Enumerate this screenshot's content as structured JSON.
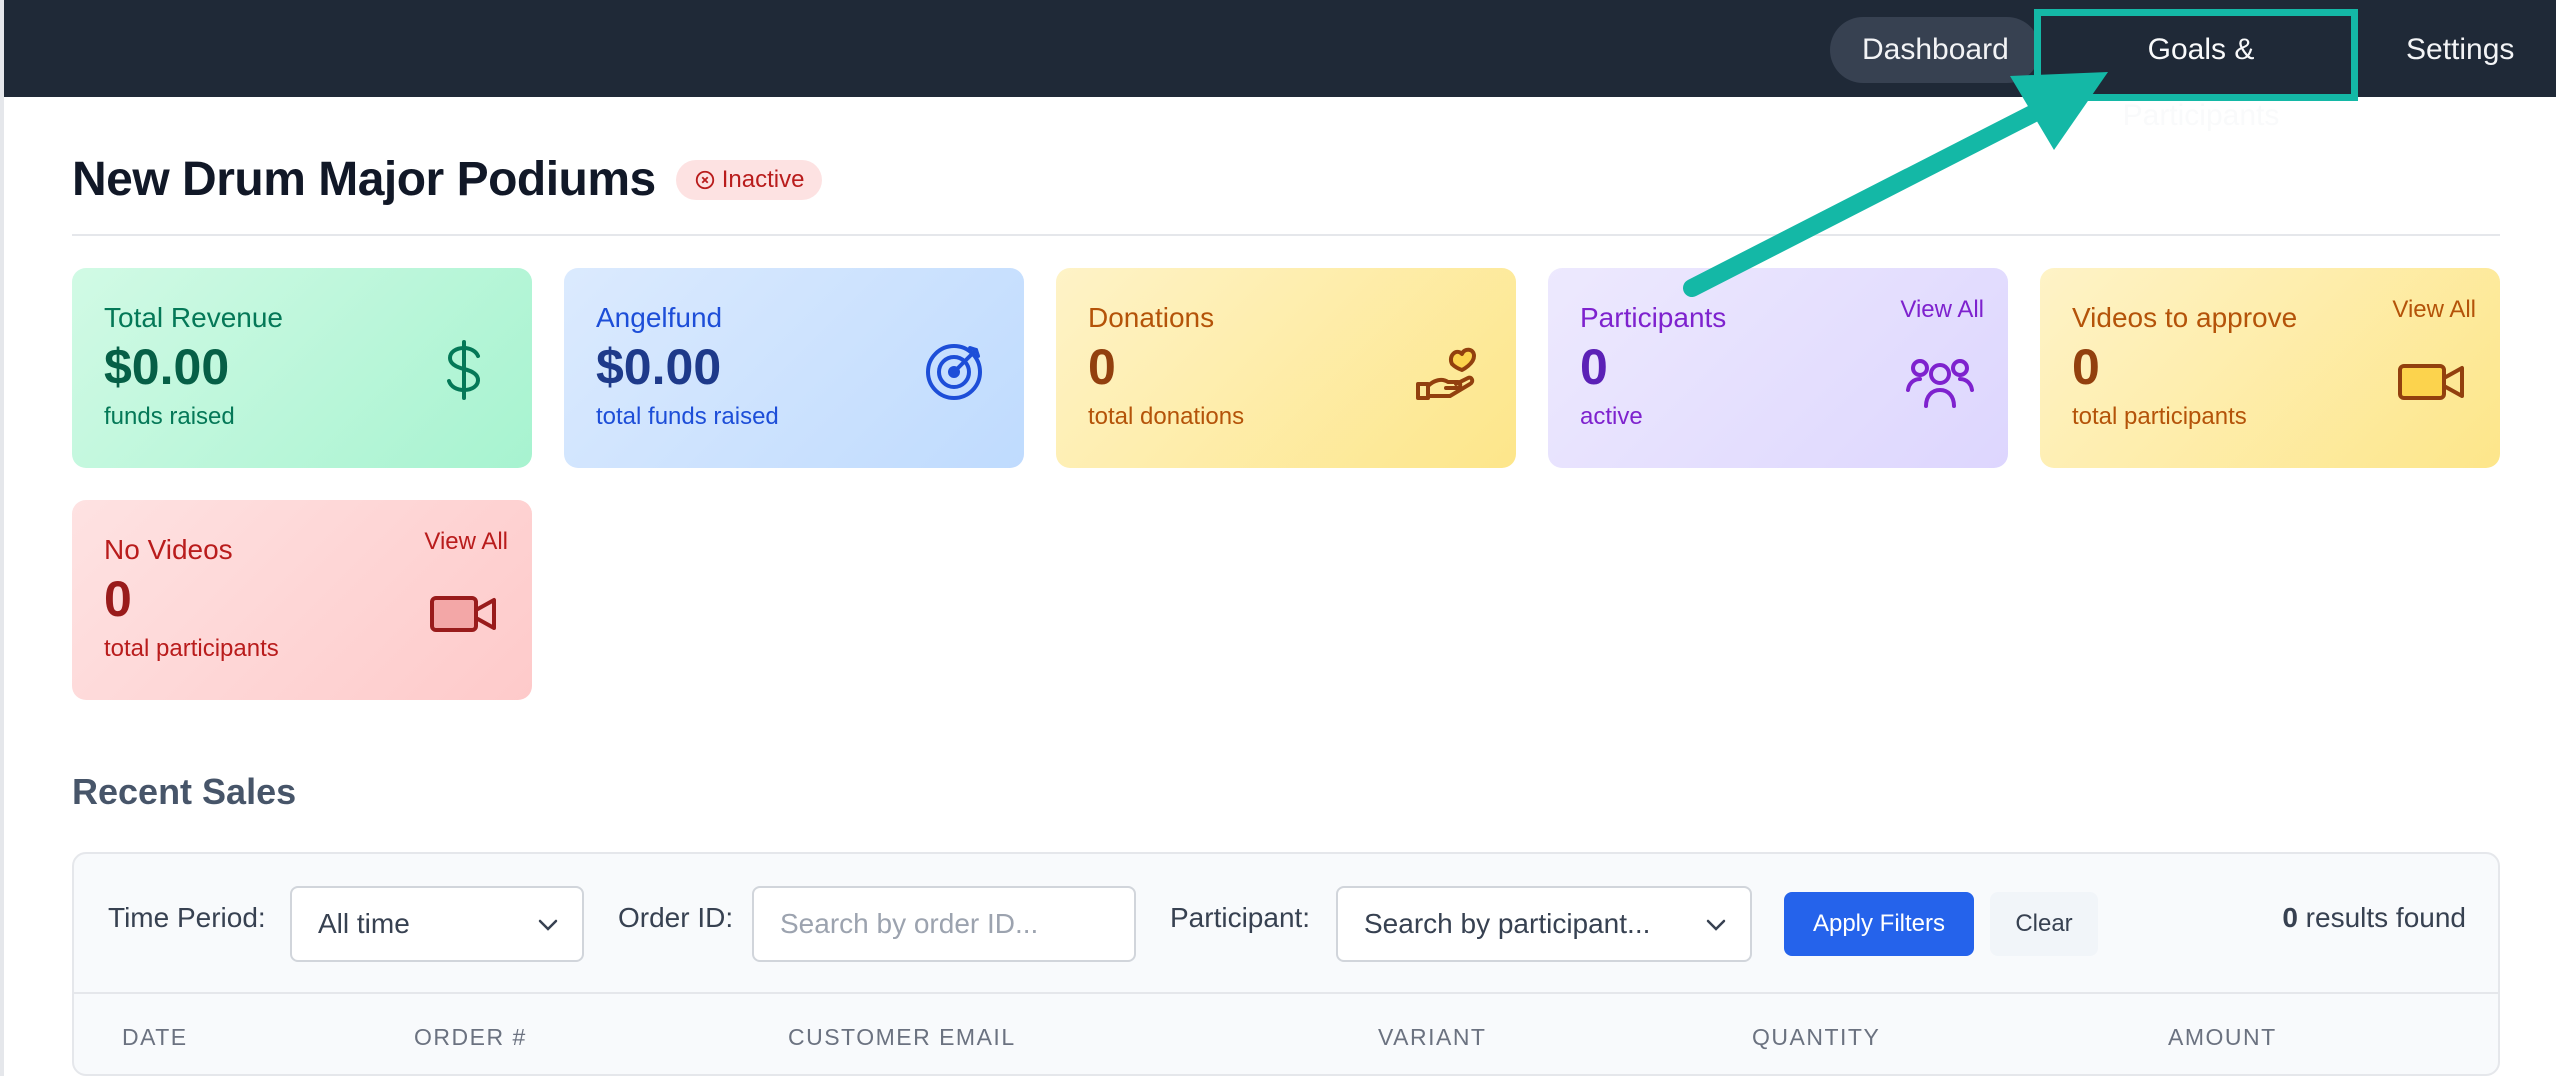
{
  "nav": {
    "dashboard": "Dashboard",
    "goals": "Goals & Participants",
    "settings": "Settings"
  },
  "page": {
    "title": "New Drum Major Podiums",
    "status": "Inactive"
  },
  "cards": {
    "revenue": {
      "label": "Total Revenue",
      "value": "$0.00",
      "sub": "funds raised",
      "icon": "dollar-icon"
    },
    "angelfund": {
      "label": "Angelfund",
      "value": "$0.00",
      "sub": "total funds raised",
      "icon": "target-icon"
    },
    "donations": {
      "label": "Donations",
      "value": "0",
      "sub": "total donations",
      "icon": "hand-heart-icon"
    },
    "participants": {
      "label": "Participants",
      "value": "0",
      "sub": "active",
      "view_all": "View All",
      "icon": "users-icon"
    },
    "videos_to_approve": {
      "label": "Videos to approve",
      "value": "0",
      "sub": "total participants",
      "view_all": "View All",
      "icon": "video-icon"
    },
    "no_videos": {
      "label": "No Videos",
      "value": "0",
      "sub": "total participants",
      "view_all": "View All",
      "icon": "video-icon"
    }
  },
  "sales": {
    "title": "Recent Sales",
    "filters": {
      "time_label": "Time Period:",
      "time_value": "All time",
      "order_label": "Order ID:",
      "order_placeholder": "Search by order ID...",
      "participant_label": "Participant:",
      "participant_placeholder": "Search by participant...",
      "apply": "Apply Filters",
      "clear": "Clear",
      "results_count": "0",
      "results_text": " results found"
    },
    "columns": [
      "DATE",
      "ORDER #",
      "CUSTOMER EMAIL",
      "VARIANT",
      "QUANTITY",
      "AMOUNT"
    ]
  },
  "colors": {
    "topbar": "#1f2937",
    "highlight": "#14b8a6",
    "primary": "#2563eb"
  }
}
